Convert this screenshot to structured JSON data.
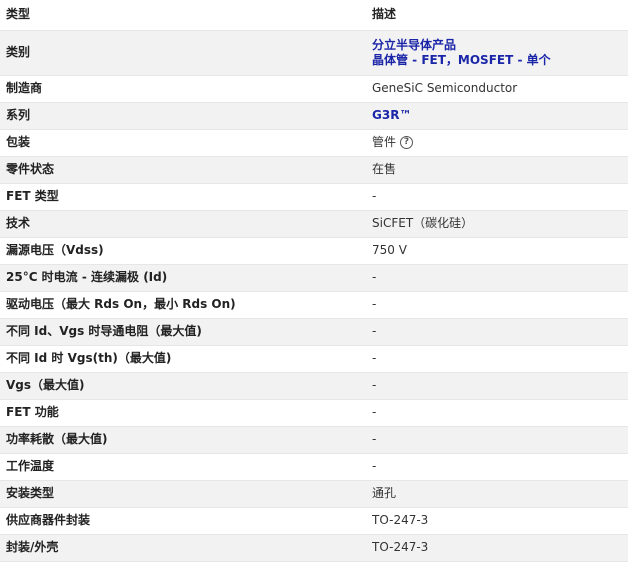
{
  "headers": {
    "type": "类型",
    "desc": "描述"
  },
  "rows": [
    {
      "label": "类别",
      "line1": "分立半导体产品",
      "line2": "晶体管 - FET，MOSFET - 单个"
    },
    {
      "label": "制造商",
      "value": "GeneSiC Semiconductor"
    },
    {
      "label": "系列",
      "value": "G3R™"
    },
    {
      "label": "包装",
      "value": "管件"
    },
    {
      "label": "零件状态",
      "value": "在售"
    },
    {
      "label": "FET 类型",
      "value": "-"
    },
    {
      "label": "技术",
      "value": "SiCFET（碳化硅）"
    },
    {
      "label": "漏源电压（Vdss)",
      "value": "750 V"
    },
    {
      "label": "25°C 时电流 - 连续漏极 (Id)",
      "value": "-"
    },
    {
      "label": "驱动电压（最大 Rds On，最小 Rds On)",
      "value": "-"
    },
    {
      "label": "不同 Id、Vgs 时导通电阻（最大值)",
      "value": "-"
    },
    {
      "label": "不同 Id 时 Vgs(th)（最大值)",
      "value": "-"
    },
    {
      "label": "Vgs（最大值)",
      "value": "-"
    },
    {
      "label": "FET 功能",
      "value": "-"
    },
    {
      "label": "功率耗散（最大值)",
      "value": "-"
    },
    {
      "label": "工作温度",
      "value": "-"
    },
    {
      "label": "安装类型",
      "value": "通孔"
    },
    {
      "label": "供应商器件封装",
      "value": "TO-247-3"
    },
    {
      "label": "封装/外壳",
      "value": "TO-247-3"
    }
  ],
  "icons": {
    "packaging_help": "help-circle-icon"
  },
  "colors": {
    "link": "#1a25a8",
    "stripe": "#f2f2f2"
  }
}
